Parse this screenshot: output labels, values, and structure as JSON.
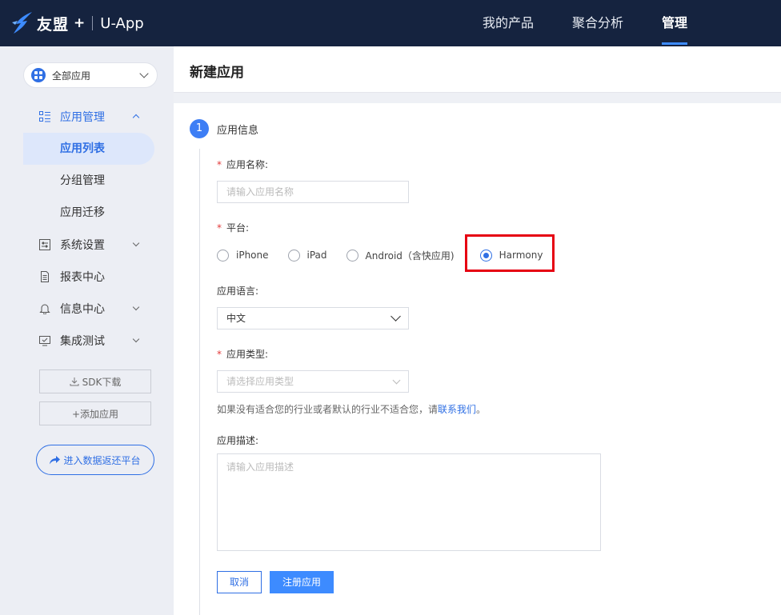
{
  "brand": {
    "name": "友盟",
    "plus": "+",
    "product": "U-App",
    "icon": "umeng-bird-logo"
  },
  "topnav": [
    {
      "label": "我的产品",
      "active": false
    },
    {
      "label": "聚合分析",
      "active": false
    },
    {
      "label": "管理",
      "active": true
    }
  ],
  "sidebar": {
    "app_select": {
      "label": "全部应用",
      "icon": "apps-grid-icon"
    },
    "menu": {
      "app_manage": {
        "label": "应用管理",
        "icon": "list-icon",
        "expanded": true
      },
      "submenu": [
        {
          "label": "应用列表",
          "active": true
        },
        {
          "label": "分组管理",
          "active": false
        },
        {
          "label": "应用迁移",
          "active": false
        }
      ],
      "system_settings": {
        "label": "系统设置",
        "icon": "settings-panel-icon"
      },
      "reports": {
        "label": "报表中心",
        "icon": "document-icon"
      },
      "messages": {
        "label": "信息中心",
        "icon": "bell-icon"
      },
      "integration": {
        "label": "集成测试",
        "icon": "monitor-check-icon"
      }
    },
    "sdk_download": "SDK下载",
    "add_app": "+添加应用",
    "data_return": "进入数据返还平台"
  },
  "page": {
    "title": "新建应用"
  },
  "form": {
    "step": {
      "number": "1",
      "label": "应用信息"
    },
    "app_name": {
      "required": "*",
      "label": "应用名称:",
      "placeholder": "请输入应用名称"
    },
    "platform": {
      "required": "*",
      "label": "平台:",
      "options": [
        {
          "label": "iPhone",
          "checked": false
        },
        {
          "label": "iPad",
          "checked": false
        },
        {
          "label": "Android（含快应用)",
          "checked": false
        },
        {
          "label": "Harmony",
          "checked": true
        }
      ]
    },
    "language": {
      "label": "应用语言:",
      "value": "中文"
    },
    "app_type": {
      "required": "*",
      "label": "应用类型:",
      "placeholder": "请选择应用类型"
    },
    "hint": {
      "text": "如果没有适合您的行业或者默认的行业不适合您，请",
      "link": "联系我们",
      "end": "。"
    },
    "description": {
      "label": "应用描述:",
      "placeholder": "请输入应用描述"
    },
    "cancel": "取消",
    "submit": "注册应用"
  },
  "colors": {
    "topbar": "#15233f",
    "primary": "#2f6fe4",
    "button": "#3d8bff",
    "highlight": "#e60012",
    "required": "#e23b3b"
  }
}
